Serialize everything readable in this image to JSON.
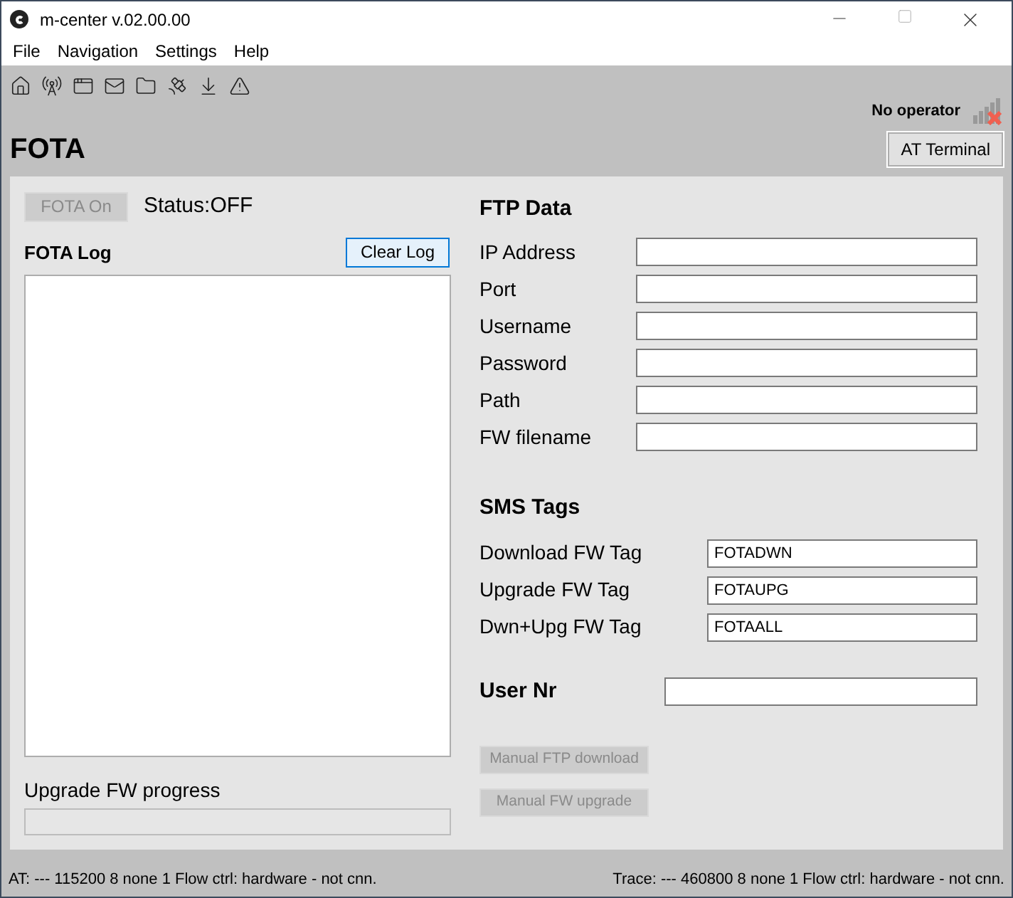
{
  "window": {
    "title": "m-center v.02.00.00"
  },
  "menu": [
    "File",
    "Navigation",
    "Settings",
    "Help"
  ],
  "operator": "No operator",
  "page_title": "FOTA",
  "at_terminal_button": "AT Terminal",
  "fota_button": {
    "label": "FOTA On",
    "disabled": true
  },
  "status": "Status:OFF",
  "log": {
    "title": "FOTA Log",
    "clear_button": {
      "label": "Clear Log",
      "default": true
    }
  },
  "progress": {
    "label": "Upgrade FW progress",
    "level": 0
  },
  "ftp": {
    "title": "FTP Data",
    "fields": [
      {
        "label": "IP Address"
      },
      {
        "label": "Port"
      },
      {
        "label": "Username"
      },
      {
        "label": "Password"
      },
      {
        "label": "Path"
      },
      {
        "label": "FW filename"
      }
    ]
  },
  "sms": {
    "title": "SMS Tags",
    "fields": [
      {
        "label": "Download FW Tag",
        "value": "FOTADWN"
      },
      {
        "label": "Upgrade FW Tag",
        "value": "FOTAUPG"
      },
      {
        "label": "Dwn+Upg FW Tag",
        "value": "FOTAALL"
      }
    ]
  },
  "user_nr": {
    "label": "User Nr"
  },
  "manual_buttons": [
    {
      "label": "Manual FTP download",
      "disabled": true
    },
    {
      "label": "Manual FW upgrade",
      "disabled": true
    }
  ],
  "status_bar": {
    "at": "AT: --- 115200 8 none 1 Flow ctrl: hardware - not cnn.",
    "trace": "Trace: --- 460800 8 none 1 Flow ctrl: hardware - not cnn."
  }
}
